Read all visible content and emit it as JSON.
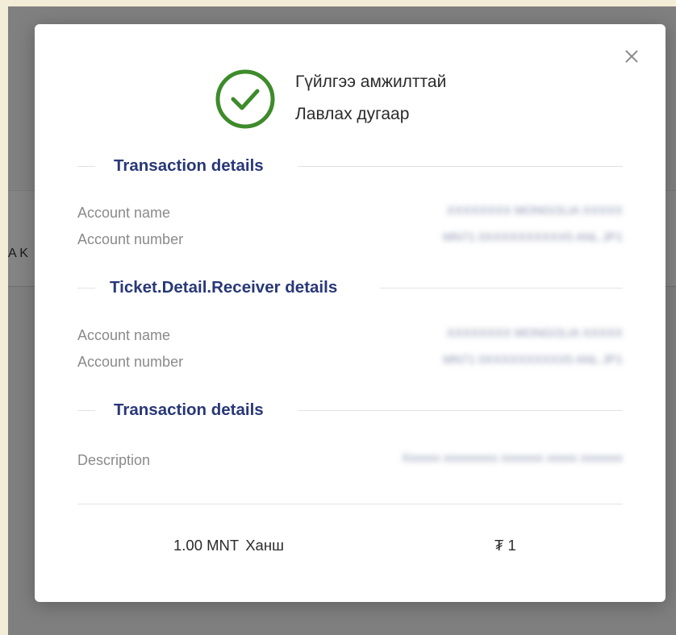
{
  "background": {
    "partial_text": "A K"
  },
  "modal": {
    "close_symbol": "✕",
    "header": {
      "title": "Гүйлгээ амжилттай",
      "reference": "Лавлах дугаар"
    },
    "sections": [
      {
        "title": "Transaction details",
        "rows": [
          {
            "label": "Account name",
            "value": "XXXXXXXX MONGOLIA XXXXX"
          },
          {
            "label": "Account number",
            "value": "MN71 0XXXXXXXXXX5 ANL JP1"
          }
        ]
      },
      {
        "title": "Ticket.Detail.Receiver details",
        "rows": [
          {
            "label": "Account name",
            "value": "XXXXXXXX MONGOLIA XXXXX"
          },
          {
            "label": "Account number",
            "value": "MN71 0XXXXXXXXXX5 ANL JP1"
          }
        ]
      },
      {
        "title": "Transaction details",
        "rows": [
          {
            "label": "Description",
            "value": "Xxxxxx xxxxxxxxx xxxxxxx xxxxx xxxxxxx"
          }
        ]
      }
    ],
    "footer": {
      "amount": "1.00 MNT",
      "rate_label": "Ханш",
      "tugrik_value": "₮ 1"
    }
  },
  "colors": {
    "accent_navy": "#283878",
    "success_green": "#3d8b2a",
    "overlay_gray": "#7f7f7f",
    "page_beige": "#f3ecd7"
  }
}
